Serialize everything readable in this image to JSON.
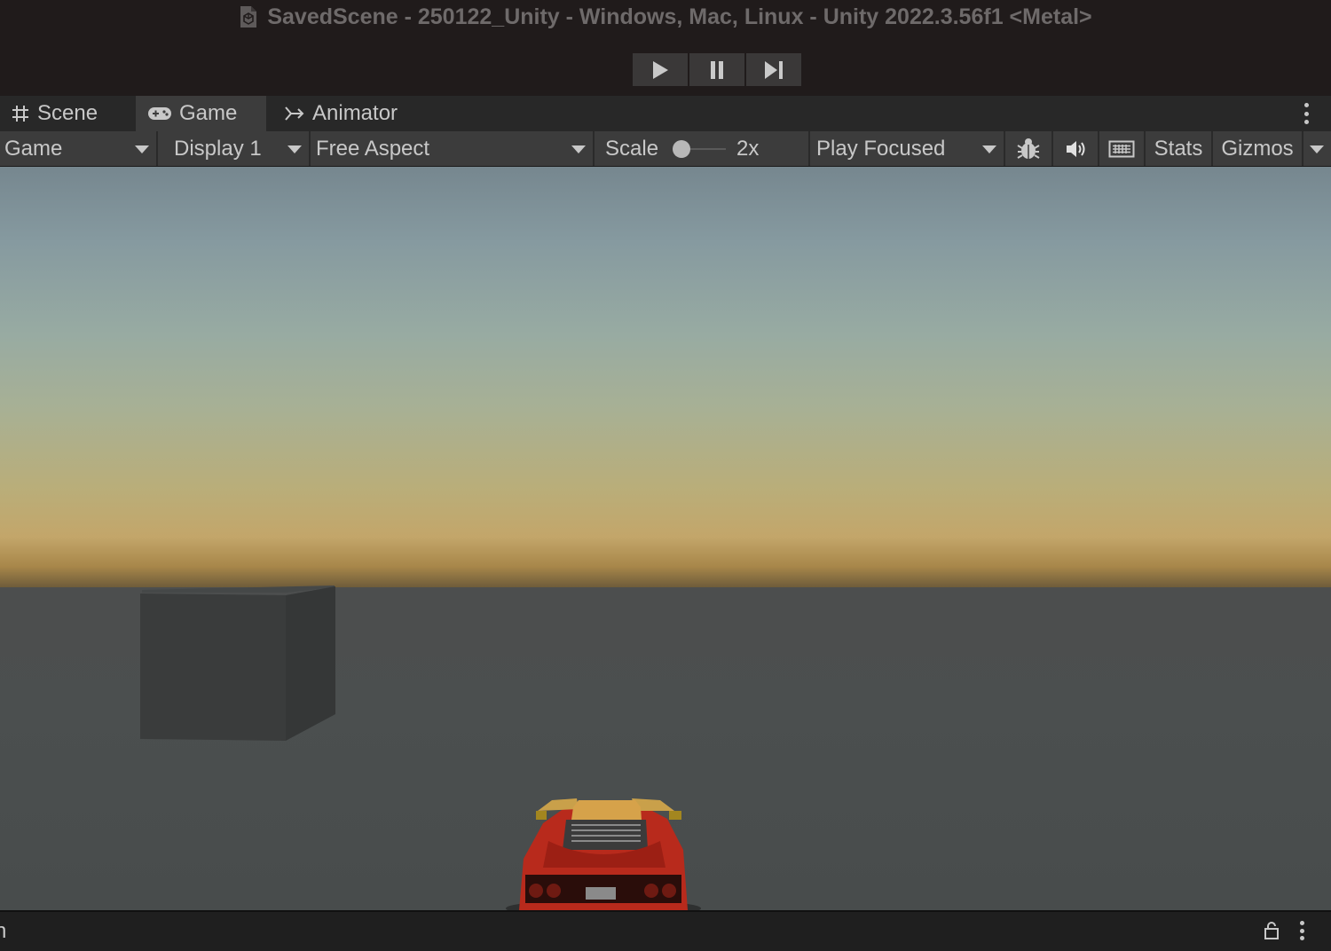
{
  "window": {
    "title": "SavedScene - 250122_Unity - Windows, Mac, Linux - Unity 2022.3.56f1 <Metal>"
  },
  "playback": {
    "play_icon": "play-icon",
    "pause_icon": "pause-icon",
    "step_icon": "step-icon"
  },
  "tabs": [
    {
      "label": "Scene",
      "icon": "grid-hash-icon"
    },
    {
      "label": "Game",
      "icon": "gamepad-icon",
      "active": true
    },
    {
      "label": "Animator",
      "icon": "animator-icon"
    }
  ],
  "toolbar": {
    "view_select": "Game",
    "display_select": "Display 1",
    "aspect_select": "Free Aspect",
    "scale_label": "Scale",
    "scale_value": "2x",
    "play_mode_select": "Play Focused",
    "stats_label": "Stats",
    "gizmos_label": "Gizmos"
  },
  "scene": {
    "sky_colors": [
      "#76878f",
      "#98aba2",
      "#c3a66a"
    ],
    "ground_color": "#4b4f4f",
    "car_color": "#b0201a"
  },
  "bottom": {
    "edge_char": "n"
  }
}
